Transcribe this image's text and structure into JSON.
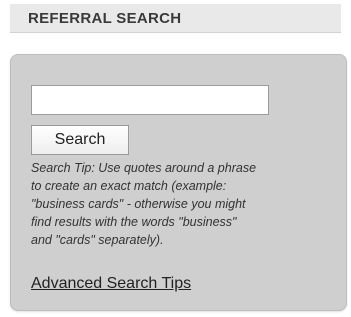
{
  "header": {
    "title": "REFERRAL SEARCH"
  },
  "search": {
    "value": "",
    "placeholder": "",
    "button_label": "Search",
    "tip": "Search Tip: Use quotes around a phrase\nto create an exact match (example:\n\"business cards\" - otherwise you might\nfind results with the words \"business\"\nand \"cards\" separately).",
    "advanced_link": "Advanced Search Tips"
  },
  "colors": {
    "header_bg": "#e9e9e9",
    "panel_bg": "#cfcfcf",
    "title_text": "#3a3a3a"
  }
}
